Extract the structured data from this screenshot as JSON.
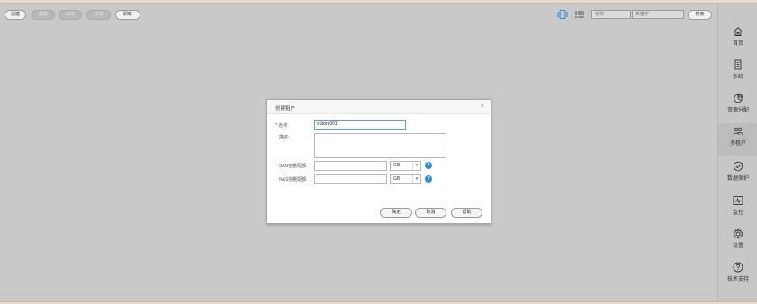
{
  "toolbar": {
    "buttons": [
      {
        "label": "创建",
        "disabled": false
      },
      {
        "label": "删除",
        "disabled": true
      },
      {
        "label": "修改",
        "disabled": true
      },
      {
        "label": "详情",
        "disabled": true
      },
      {
        "label": "刷新",
        "disabled": false
      }
    ],
    "search": {
      "name_field": "名称",
      "keyword_placeholder": "关键字",
      "search_label": "搜索"
    },
    "views": [
      "card-view-icon",
      "list-view-icon"
    ]
  },
  "sidebar": {
    "items": [
      {
        "label": "首页",
        "icon": "home-icon"
      },
      {
        "label": "系统",
        "icon": "system-icon"
      },
      {
        "label": "资源分配",
        "icon": "resource-allocation-icon"
      },
      {
        "label": "多租户",
        "icon": "multi-tenant-icon",
        "active": true
      },
      {
        "label": "数据保护",
        "icon": "data-protection-icon"
      },
      {
        "label": "监控",
        "icon": "monitor-icon"
      },
      {
        "label": "设置",
        "icon": "settings-icon"
      },
      {
        "label": "技术支持",
        "icon": "support-icon"
      }
    ]
  },
  "dialog": {
    "title": "创建租户",
    "close": "×",
    "fields": {
      "name_label": "名称:",
      "name_required": "*",
      "name_value": "vStore001",
      "desc_label": "描述:",
      "san_label": "SAN容量配额:",
      "san_unit": "GB",
      "nas_label": "NAS容量配额:",
      "nas_unit": "GB",
      "help": "?"
    },
    "buttons": {
      "ok": "确定",
      "cancel": "取消",
      "help": "帮助"
    }
  },
  "colors": {
    "background": "#c9c9c9",
    "accent": "#2a8fdc",
    "required": "#d2302f"
  }
}
